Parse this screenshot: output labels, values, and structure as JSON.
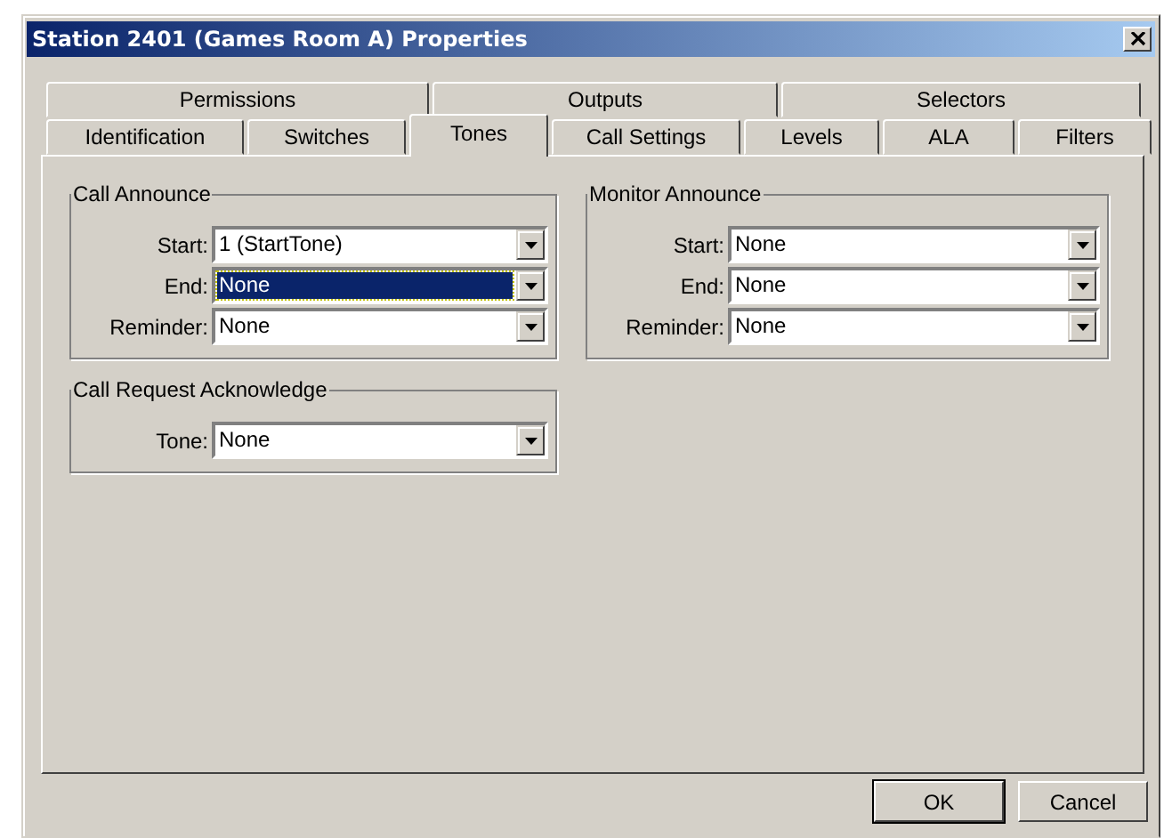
{
  "window": {
    "title": "Station 2401 (Games Room A) Properties"
  },
  "tab_rows": [
    {
      "tabs": [
        {
          "label": "Permissions",
          "selected": false
        },
        {
          "label": "Outputs",
          "selected": false
        },
        {
          "label": "Selectors",
          "selected": false
        }
      ]
    },
    {
      "tabs": [
        {
          "label": "Identification",
          "selected": false
        },
        {
          "label": "Switches",
          "selected": false
        },
        {
          "label": "Tones",
          "selected": true
        },
        {
          "label": "Call Settings",
          "selected": false
        },
        {
          "label": "Levels",
          "selected": false
        },
        {
          "label": "ALA",
          "selected": false
        },
        {
          "label": "Filters",
          "selected": false
        }
      ]
    }
  ],
  "groups": [
    {
      "title": "Call Announce",
      "fields": [
        {
          "label": "Start:",
          "value": "1 (StartTone)",
          "focused": false
        },
        {
          "label": "End:",
          "value": "None",
          "focused": true
        },
        {
          "label": "Reminder:",
          "value": "None",
          "focused": false
        }
      ]
    },
    {
      "title": "Monitor Announce",
      "fields": [
        {
          "label": "Start:",
          "value": "None",
          "focused": false
        },
        {
          "label": "End:",
          "value": "None",
          "focused": false
        },
        {
          "label": "Reminder:",
          "value": "None",
          "focused": false
        }
      ]
    },
    {
      "title": "Call Request Acknowledge",
      "fields": [
        {
          "label": "Tone:",
          "value": "None",
          "focused": false
        }
      ]
    }
  ],
  "buttons": [
    {
      "label": "OK",
      "default": true
    },
    {
      "label": "Cancel",
      "default": false
    }
  ]
}
